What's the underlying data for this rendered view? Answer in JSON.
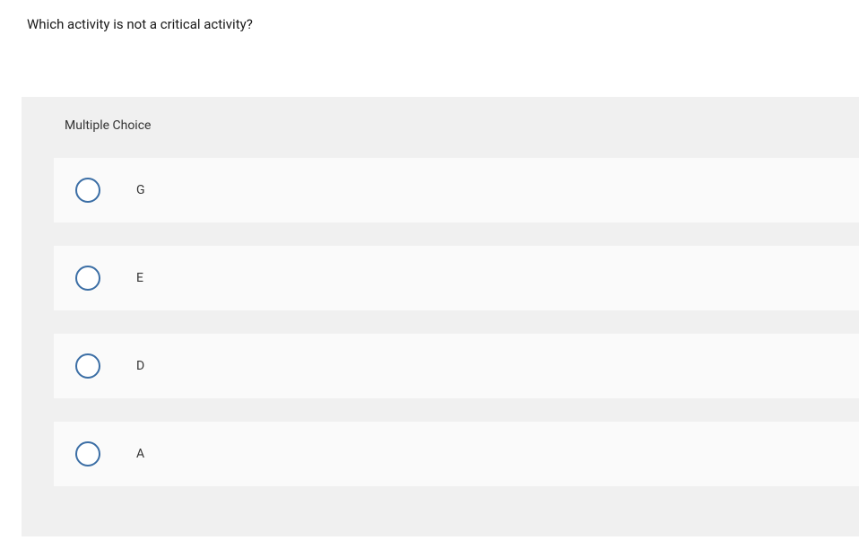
{
  "question": {
    "text": "Which activity is not a critical activity?"
  },
  "section": {
    "header": "Multiple Choice"
  },
  "options": [
    {
      "label": "G"
    },
    {
      "label": "E"
    },
    {
      "label": "D"
    },
    {
      "label": "A"
    }
  ]
}
